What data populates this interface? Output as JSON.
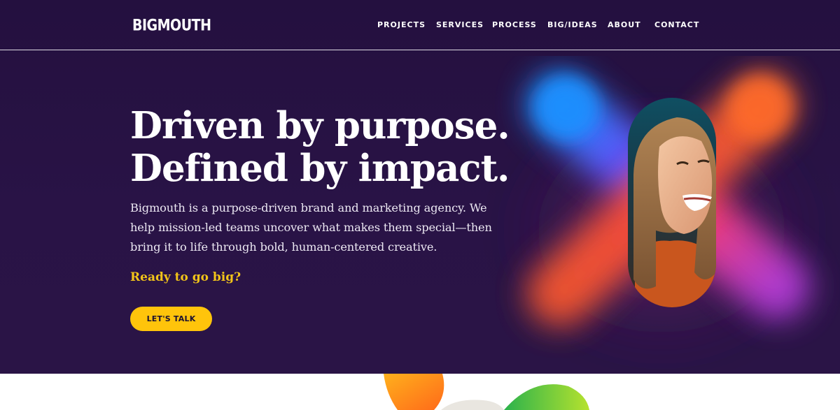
{
  "brand": {
    "logo_text": "BIGMOUTH"
  },
  "nav": {
    "items": [
      {
        "label": "PROJECTS"
      },
      {
        "label": "SERVICES"
      },
      {
        "label": "PROCESS"
      },
      {
        "label": "BIG/IDEAS"
      },
      {
        "label": "ABOUT"
      },
      {
        "label": "CONTACT"
      }
    ]
  },
  "hero": {
    "headline_line1": "Driven by purpose.",
    "headline_line2": "Defined by impact.",
    "intro": "Bigmouth is a purpose-driven brand and marketing agency. We help mission-led teams uncover what makes them special—then bring it to life through bold, human-centered creative.",
    "prompt": "Ready to go big?",
    "cta_label": "LET'S TALK"
  },
  "colors": {
    "hero_background": "#291346",
    "accent_yellow": "#ffc40b",
    "prompt_yellow": "#f2c419",
    "text_white": "#ffffff"
  },
  "icons": {
    "hero_art": "gradient-x-shape",
    "hero_photo": "smiling-woman-portrait"
  }
}
